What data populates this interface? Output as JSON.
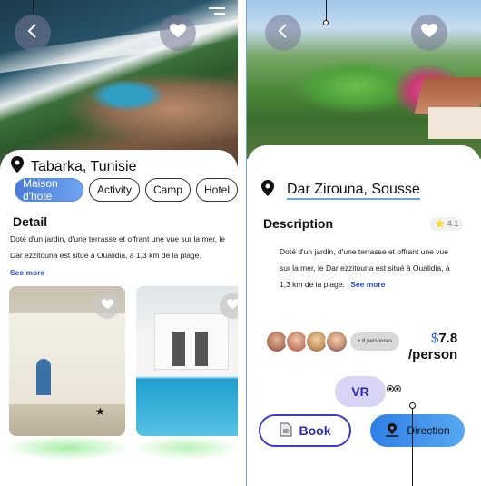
{
  "left": {
    "location": "Tabarka, Tunisie",
    "chips": [
      {
        "label": "Maison d'hote"
      },
      {
        "label": "Activity"
      },
      {
        "label": "Camp"
      },
      {
        "label": "Hotel"
      }
    ],
    "detail_title": "Detail",
    "description": "Doté d'un jardin, d'une terrasse et offrant une vue sur la mer, le Dar ezzitouna est situé à Oualidia, à 1,3 km de la plage.",
    "see_more": "See more",
    "star": "★"
  },
  "right": {
    "location": "Dar Zirouna, Sousse",
    "description_title": "Description",
    "rating": "⭐ 4.1",
    "description": "Doté d'un jardin, d'une terrasse et offrant une vue sur la mer, le Dar ezzitouna est situé à Oualidia, à 1,3 km de la plage.",
    "see_more": "See more",
    "persons": "+ 8 personnes",
    "price_currency": "$",
    "price_value": "7.8",
    "price_unit": "/person",
    "vr_label": "VR",
    "book_label": "Book",
    "direction_label": "Direction"
  },
  "colors": {
    "accent_blue": "#4a7bd8",
    "link_blue": "#2a4fd0",
    "book_border": "#3a3ad0",
    "vr_bg": "#d8d4f5"
  }
}
